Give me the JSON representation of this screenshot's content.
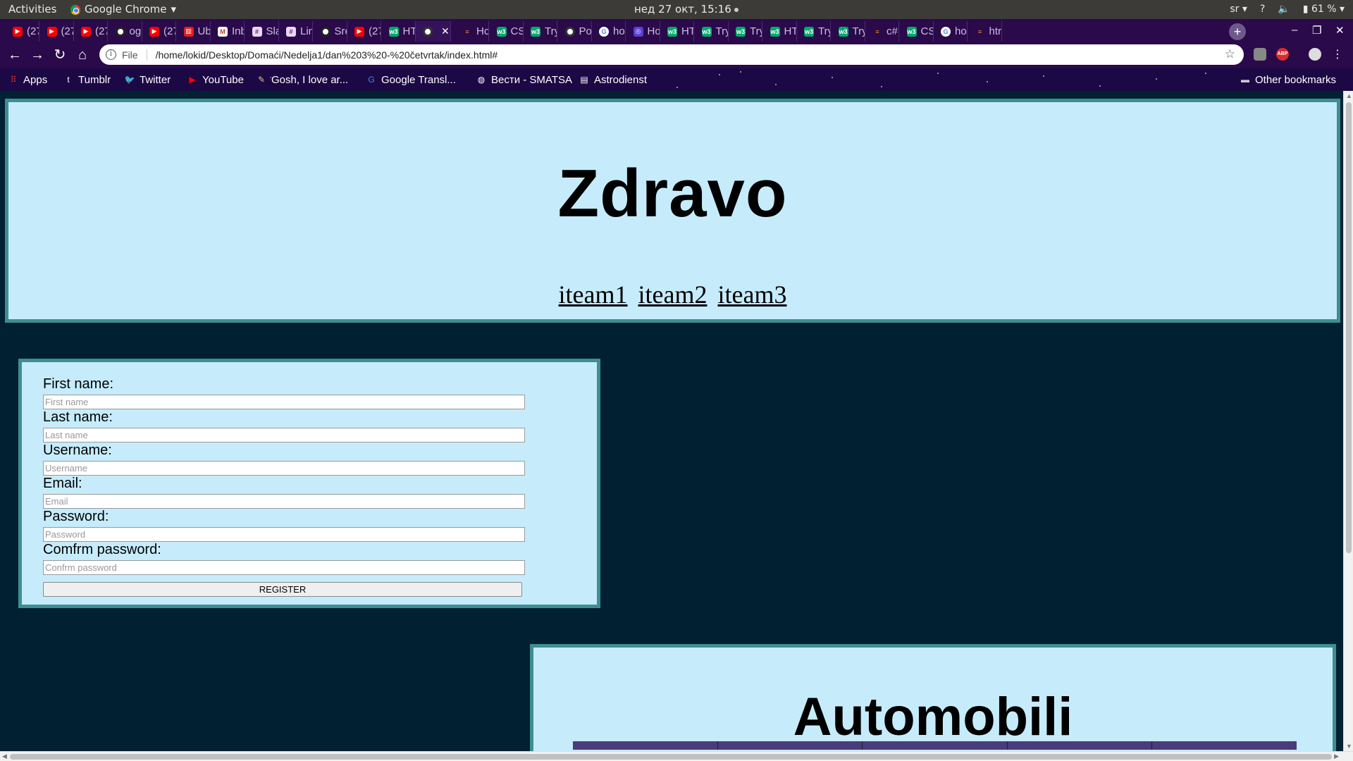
{
  "system_bar": {
    "activities": "Activities",
    "app_name": "Google Chrome",
    "clock": "нед 27 окт, 15:16",
    "keyboard_layout": "sr",
    "battery": "61 %"
  },
  "tabs": [
    {
      "icon": "youtube-icon",
      "label": "(27"
    },
    {
      "icon": "youtube-icon",
      "label": "(27"
    },
    {
      "icon": "youtube-icon",
      "label": "(27"
    },
    {
      "icon": "github-icon",
      "label": "og"
    },
    {
      "icon": "youtube-icon",
      "label": "(27"
    },
    {
      "icon": "ub-icon",
      "label": "Ub"
    },
    {
      "icon": "gmail-icon",
      "label": "Inb"
    },
    {
      "icon": "slack-icon",
      "label": "Sla"
    },
    {
      "icon": "slack-icon",
      "label": "Lin"
    },
    {
      "icon": "github-icon",
      "label": "Sre"
    },
    {
      "icon": "youtube-icon",
      "label": "(27"
    },
    {
      "icon": "w3schools-icon",
      "label": "HT"
    },
    {
      "icon": "globe-icon",
      "label": "",
      "active": true
    },
    {
      "icon": "stackoverflow-icon",
      "label": "Ho"
    },
    {
      "icon": "w3schools-icon",
      "label": "CS"
    },
    {
      "icon": "w3schools-icon",
      "label": "Try"
    },
    {
      "icon": "globe-icon",
      "label": "Po"
    },
    {
      "icon": "google-icon",
      "label": "ho"
    },
    {
      "icon": "hashnode-icon",
      "label": "Ho"
    },
    {
      "icon": "w3schools-icon",
      "label": "HT"
    },
    {
      "icon": "w3schools-icon",
      "label": "Try"
    },
    {
      "icon": "w3schools-icon",
      "label": "Try"
    },
    {
      "icon": "w3schools-icon",
      "label": "HT"
    },
    {
      "icon": "w3schools-icon",
      "label": "Try"
    },
    {
      "icon": "w3schools-icon",
      "label": "Try"
    },
    {
      "icon": "stackoverflow-icon",
      "label": "c#"
    },
    {
      "icon": "w3schools-icon",
      "label": "CS"
    },
    {
      "icon": "google-icon",
      "label": "ho"
    },
    {
      "icon": "stackoverflow-icon",
      "label": "htr"
    }
  ],
  "toolbar": {
    "file_label": "File",
    "url": "/home/lokid/Desktop/Domaći/Nedelja1/dan%203%20-%20četvrtak/index.html#"
  },
  "bookmarks": [
    {
      "icon": "apps-grid-icon",
      "label": "Apps"
    },
    {
      "icon": "tumblr-icon",
      "label": "Tumblr"
    },
    {
      "icon": "twitter-icon",
      "label": "Twitter"
    },
    {
      "icon": "youtube-icon",
      "label": "YouTube"
    },
    {
      "icon": "art-icon",
      "label": "Gosh, I love ar..."
    },
    {
      "icon": "translate-icon",
      "label": "Google Transl..."
    },
    {
      "icon": "globe-icon",
      "label": "Вести - SMATSA"
    },
    {
      "icon": "astrodienst-icon",
      "label": "Astrodienst"
    }
  ],
  "other_bookmarks": "Other bookmarks",
  "page": {
    "title": "Zdravo",
    "nav": [
      "iteam1",
      "iteam2",
      "iteam3"
    ],
    "form": {
      "fields": [
        {
          "label": "First name:",
          "placeholder": "First name"
        },
        {
          "label": "Last name:",
          "placeholder": "Last name"
        },
        {
          "label": "Username:",
          "placeholder": "Username"
        },
        {
          "label": "Email:",
          "placeholder": "Email"
        },
        {
          "label": "Password:",
          "placeholder": "Password"
        },
        {
          "label": "Comfrm password:",
          "placeholder": "Confrm password"
        }
      ],
      "submit": "REGISTER"
    },
    "cars_title": "Automobili"
  },
  "colors": {
    "page_bg": "#012133",
    "box_bg": "#c6ecfc",
    "box_border": "#3f8e92",
    "browser_frame": "#2a0a4a"
  }
}
